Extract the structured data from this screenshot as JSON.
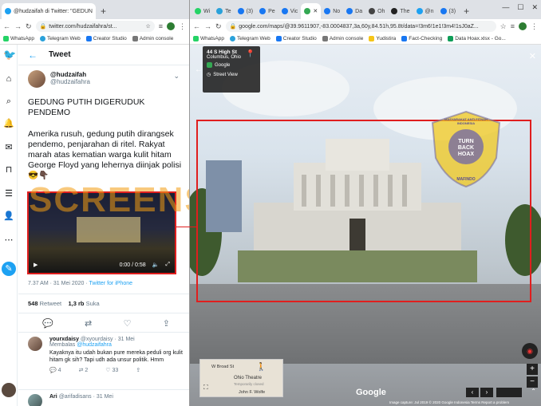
{
  "left_window": {
    "tabs": [
      {
        "label": "@hudzaifah di Twitter: \"GEDUN",
        "active": true
      }
    ],
    "url": "twitter.com/hudzaifahra/st...",
    "bookmarks": [
      "WhatsApp",
      "Telegram Web",
      "Creator Studio",
      "Admin console"
    ]
  },
  "right_window": {
    "tabs": [
      "Wi",
      "Te",
      "(3)",
      "Pe",
      "Vic",
      "",
      "No",
      "Da",
      "Oh",
      "The",
      "@n",
      "(3)"
    ],
    "url": "google.com/maps/@39.9611907,-83.0004837,3a,60y,84.51h,95.8t/data=!3m6!1e1!3m4!1sJ0aZ...",
    "bookmarks": [
      "WhatsApp",
      "Telegram Web",
      "Creator Studio",
      "Admin console",
      "Yudistira",
      "Fact-Checking",
      "Data Hoax.xlsx - Go..."
    ]
  },
  "twitter": {
    "header_title": "Tweet",
    "display_name": "@hudzaifah",
    "handle": "@hudzaifahra",
    "tweet_headline": "GEDUNG PUTIH DIGERUDUK PENDEMO",
    "tweet_body": "Amerika rusuh, gedung putih dirangsek pendemo, penjarahan di ritel. Rakyat marah atas kematian warga kulit hitam George Floyd yang lehernya diinjak polisi",
    "tweet_emoji": "😎👇🏿",
    "video_time": "0:00 / 0:58",
    "timestamp": "7.37 AM · 31 Mei 2020 · ",
    "source": "Twitter for iPhone",
    "retweets_count": "548",
    "retweets_label": "Retweet",
    "likes_count": "1,3 rb",
    "likes_label": "Suka",
    "replies": [
      {
        "name": "yourxdaisy",
        "handle_date": "@xyourdaisy · 31 Mei",
        "replying_to_prefix": "Membalas ",
        "replying_to": "@hudzaifahra",
        "text": "Kayaknya itu udah bukan pure mereka peduli org kulit hitam gk sih? Tapi udh ada unsur politik. Hmm",
        "reply_count": "4",
        "retweet_count": "2",
        "like_count": "33"
      },
      {
        "name": "Ari",
        "handle_date": "@arifadisans · 31 Mei"
      }
    ]
  },
  "maps": {
    "address_title": "44 S High St",
    "address_sub": "Columbus, Ohio",
    "provider": "Google",
    "mode_label": "Street View",
    "minimap_labels": [
      "W Broad St",
      "Ohio Theatre",
      "Temporarily closed",
      "John F. Wolfe"
    ],
    "google_logo": "Google",
    "footer": "Image capture: Jul 2019   © 2020 Google   Indonesia   Terms   Report a problem"
  },
  "overlays": {
    "watermark_text": "SCREENSHOT BY",
    "stamp_ring_text": "MASYARAKAT ANTI FITNAH INDONESIA",
    "stamp_center": "TURN BACK HOAX",
    "stamp_bottom": "MAFINDO"
  },
  "colors": {
    "twitter_blue": "#1da1f2",
    "highlight_red": "#e01e1e",
    "watermark_orange": "#f39c12"
  }
}
